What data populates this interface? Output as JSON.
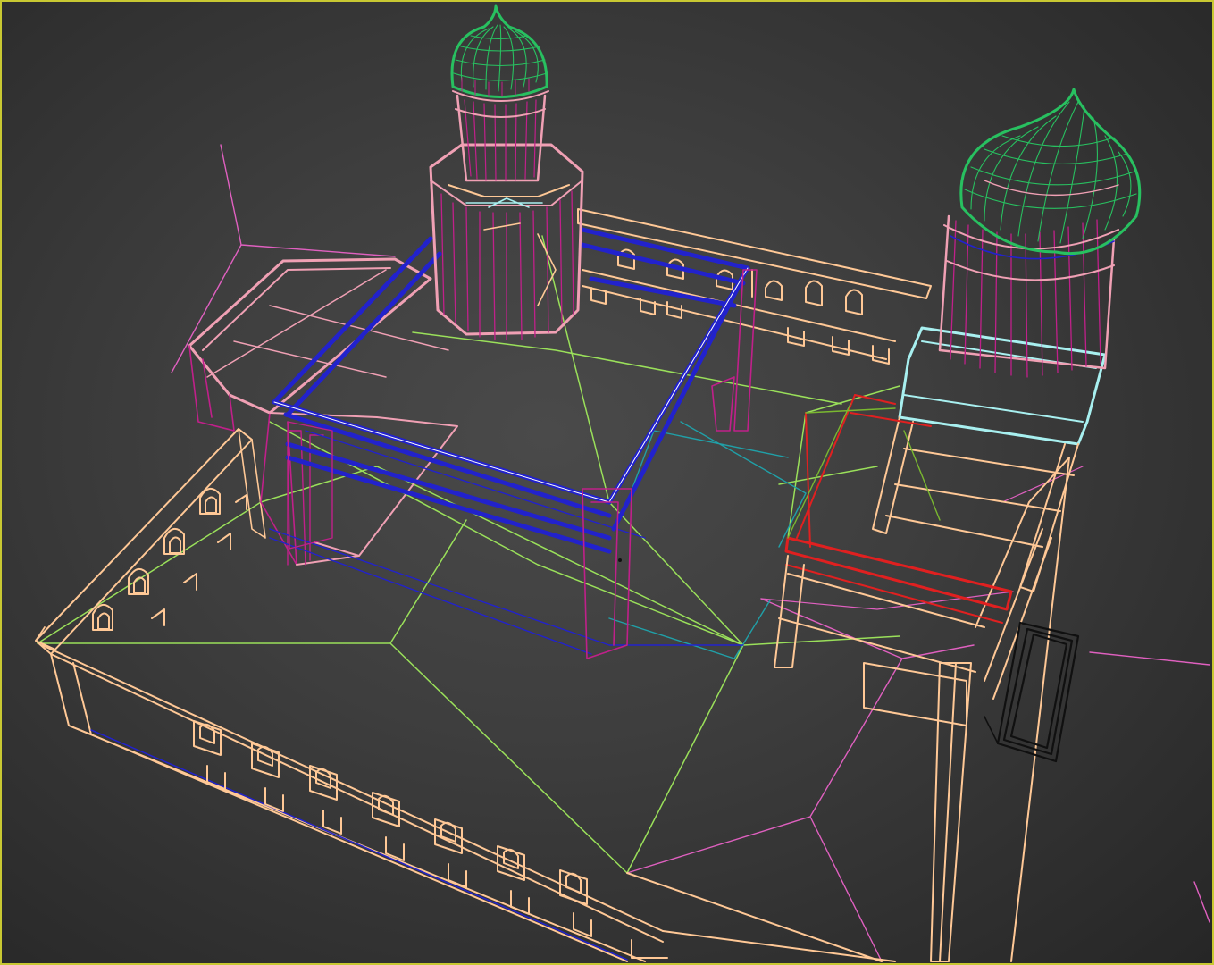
{
  "viewport": {
    "border_color": "#c8c832",
    "background_color": "#3a3a3a",
    "render_mode": "wireframe"
  },
  "colors": {
    "outer_wall": "#ffc896",
    "inner_wall_blue": "#2222cc",
    "courtyard_guides": "#9ae05a",
    "tower_drum": "#f0a0b4",
    "tower_magenta": "#c0208a",
    "dome": "#28c060",
    "tower_base_cyan": "#a8f0f0",
    "stair_red": "#e02020",
    "roof_pink": "#e060c0",
    "teal_guides": "#20a0a8",
    "black_frame": "#101010"
  }
}
